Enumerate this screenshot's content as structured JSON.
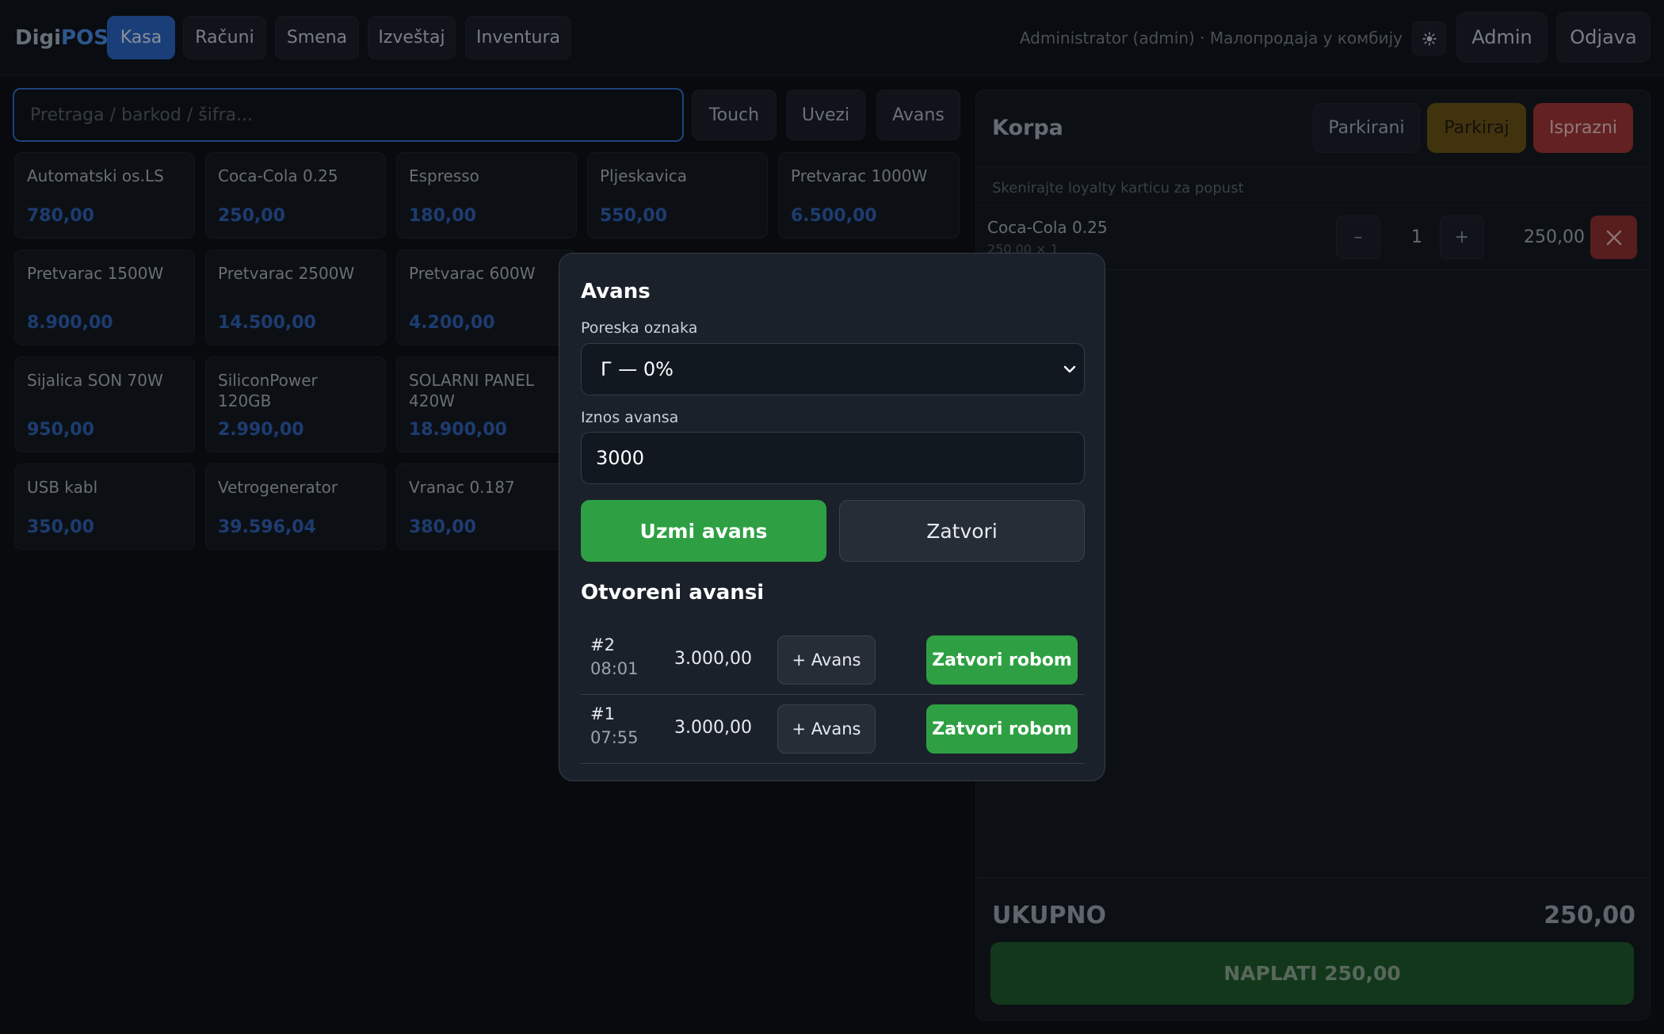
{
  "header": {
    "logo_part1": "Digi",
    "logo_part2": "POS",
    "tabs": [
      {
        "label": "Kasa",
        "active": true
      },
      {
        "label": "Računi"
      },
      {
        "label": "Smena"
      },
      {
        "label": "Izveštaj"
      },
      {
        "label": "Inventura"
      }
    ],
    "user_info": "Administrator (admin) · Малопродаја у комбију",
    "theme_icon": "sun-icon",
    "admin_label": "Admin",
    "logout_label": "Odjava"
  },
  "search": {
    "placeholder": "Pretraga / barkod / šifra..."
  },
  "toolbar": {
    "touch_label": "Touch",
    "import_label": "Uvezi",
    "advance_label": "Avans"
  },
  "products": [
    {
      "name": "Automatski os.LS",
      "price": "780,00"
    },
    {
      "name": "Coca-Cola 0.25",
      "price": "250,00"
    },
    {
      "name": "Espresso",
      "price": "180,00"
    },
    {
      "name": "Pljeskavica",
      "price": "550,00"
    },
    {
      "name": "Pretvarac 1000W",
      "price": "6.500,00"
    },
    {
      "name": "Pretvarac 1500W",
      "price": "8.900,00"
    },
    {
      "name": "Pretvarac 2500W",
      "price": "14.500,00"
    },
    {
      "name": "Pretvarac 600W",
      "price": "4.200,00"
    },
    {
      "name": "Sijalica SON 70W",
      "price": "950,00"
    },
    {
      "name": "SiliconPower 120GB",
      "price": "2.990,00"
    },
    {
      "name": "SOLARNI PANEL 420W",
      "price": "18.900,00"
    },
    {
      "name": "USB kabl",
      "price": "350,00"
    },
    {
      "name": "Vetrogenerator",
      "price": "39.596,04"
    },
    {
      "name": "Vranac 0.187",
      "price": "380,00"
    }
  ],
  "cart": {
    "title": "Korpa",
    "parked_label": "Parkirani",
    "park_label": "Parkiraj",
    "clear_label": "Isprazni",
    "loyalty_hint": "Skenirajte loyalty karticu za popust",
    "items": [
      {
        "name": "Coca-Cola 0.25",
        "sub": "250,00 × 1",
        "qty": "1",
        "total": "250,00",
        "minus": "–",
        "plus": "+"
      }
    ],
    "total_label": "UKUPNO",
    "total_value": "250,00",
    "pay_label": "NAPLATI 250,00"
  },
  "modal": {
    "title": "Avans",
    "tax_label": "Poreska oznaka",
    "tax_value": "Г — 0%",
    "amount_label": "Iznos avansa",
    "amount_value": "3000",
    "take_label": "Uzmi avans",
    "close_label": "Zatvori",
    "open_title": "Otvoreni avansi",
    "open_advances": [
      {
        "id": "#2",
        "time": "08:01",
        "amount": "3.000,00",
        "plus_label": "+ Avans",
        "close_label": "Zatvori robom"
      },
      {
        "id": "#1",
        "time": "07:55",
        "amount": "3.000,00",
        "plus_label": "+ Avans",
        "close_label": "Zatvori robom"
      }
    ]
  },
  "colors": {
    "accent": "#2b66c2",
    "price": "#2f62b5",
    "success": "#2ea043",
    "danger": "#8e2f2f",
    "warning": "#6b5319"
  }
}
